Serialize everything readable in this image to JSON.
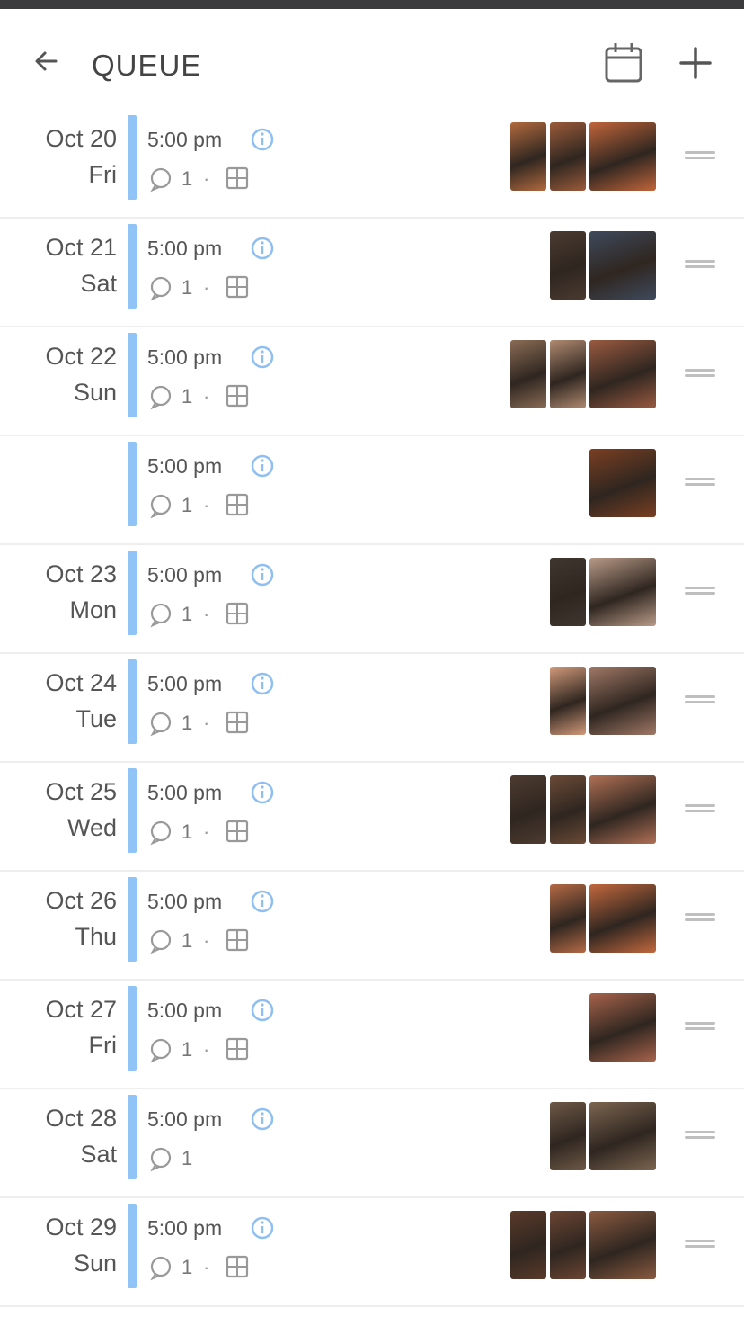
{
  "header": {
    "title": "QUEUE",
    "back_icon": "arrow-left-icon",
    "calendar_icon": "calendar-icon",
    "add_icon": "plus-icon"
  },
  "colors": {
    "accent_bar": "#90c4f7",
    "info_icon": "#8fbff2"
  },
  "rows": [
    {
      "month_day": "Oct 20",
      "weekday": "Fri",
      "time": "5:00 pm",
      "count": "1",
      "show_tile": true,
      "thumbs": [
        {
          "w": "narrow",
          "c": "#b06a3e"
        },
        {
          "w": "narrow",
          "c": "#9a5b3a"
        },
        {
          "w": "wide",
          "c": "#c0653a"
        }
      ]
    },
    {
      "month_day": "Oct 21",
      "weekday": "Sat",
      "time": "5:00 pm",
      "count": "1",
      "show_tile": true,
      "thumbs": [
        {
          "w": "narrow",
          "c": "#4a3a30"
        },
        {
          "w": "wide",
          "c": "#3f4a5c"
        }
      ]
    },
    {
      "month_day": "Oct 22",
      "weekday": "Sun",
      "time": "5:00 pm",
      "count": "1",
      "show_tile": true,
      "thumbs": [
        {
          "w": "narrow",
          "c": "#8a6c55"
        },
        {
          "w": "narrow",
          "c": "#b08a70"
        },
        {
          "w": "wide",
          "c": "#9a5a40"
        }
      ]
    },
    {
      "month_day": "",
      "weekday": "",
      "time": "5:00 pm",
      "count": "1",
      "show_tile": true,
      "thumbs": [
        {
          "w": "wide",
          "c": "#7a3f22"
        }
      ]
    },
    {
      "month_day": "Oct 23",
      "weekday": "Mon",
      "time": "5:00 pm",
      "count": "1",
      "show_tile": true,
      "thumbs": [
        {
          "w": "narrow",
          "c": "#3f3630"
        },
        {
          "w": "wide",
          "c": "#b99b88"
        }
      ]
    },
    {
      "month_day": "Oct 24",
      "weekday": "Tue",
      "time": "5:00 pm",
      "count": "1",
      "show_tile": true,
      "thumbs": [
        {
          "w": "narrow",
          "c": "#d29a7a"
        },
        {
          "w": "wide",
          "c": "#a07866"
        }
      ]
    },
    {
      "month_day": "Oct 25",
      "weekday": "Wed",
      "time": "5:00 pm",
      "count": "1",
      "show_tile": true,
      "thumbs": [
        {
          "w": "narrow",
          "c": "#4d3b30"
        },
        {
          "w": "narrow",
          "c": "#6a4a36"
        },
        {
          "w": "wide",
          "c": "#b07055"
        }
      ]
    },
    {
      "month_day": "Oct 26",
      "weekday": "Thu",
      "time": "5:00 pm",
      "count": "1",
      "show_tile": true,
      "thumbs": [
        {
          "w": "narrow",
          "c": "#b46a45"
        },
        {
          "w": "wide",
          "c": "#c1683d"
        }
      ]
    },
    {
      "month_day": "Oct 27",
      "weekday": "Fri",
      "time": "5:00 pm",
      "count": "1",
      "show_tile": true,
      "thumbs": [
        {
          "w": "wide",
          "c": "#a7634b"
        }
      ]
    },
    {
      "month_day": "Oct 28",
      "weekday": "Sat",
      "time": "5:00 pm",
      "count": "1",
      "show_tile": false,
      "thumbs": [
        {
          "w": "narrow",
          "c": "#6d5846"
        },
        {
          "w": "wide",
          "c": "#7b6550"
        }
      ]
    },
    {
      "month_day": "Oct 29",
      "weekday": "Sun",
      "time": "5:00 pm",
      "count": "1",
      "show_tile": true,
      "thumbs": [
        {
          "w": "narrow",
          "c": "#5a3a2a"
        },
        {
          "w": "narrow",
          "c": "#6b4533"
        },
        {
          "w": "wide",
          "c": "#8a5a40"
        }
      ]
    }
  ]
}
